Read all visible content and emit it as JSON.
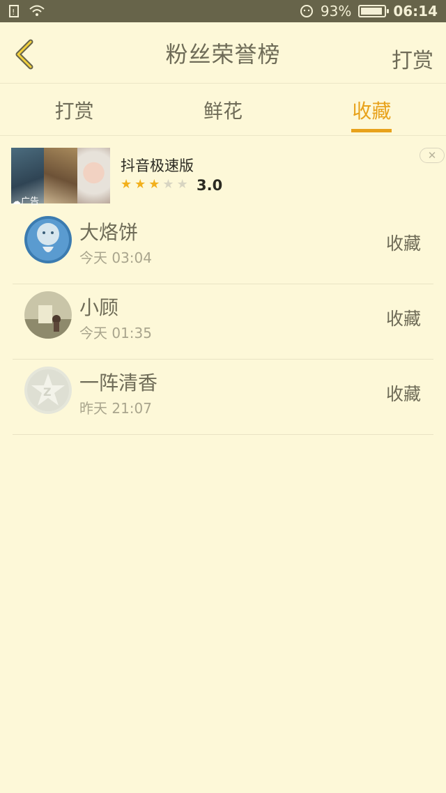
{
  "status_bar": {
    "battery": "93%",
    "battery_level": 0.93,
    "time": "06:14"
  },
  "header": {
    "title": "粉丝荣誉榜",
    "action_label": "打赏"
  },
  "tabs": [
    {
      "label": "打赏",
      "active": false
    },
    {
      "label": "鲜花",
      "active": false
    },
    {
      "label": "收藏",
      "active": true
    }
  ],
  "ad": {
    "name": "抖音极速版",
    "rating": "3.0",
    "stars_filled": 3,
    "stars_total": 5,
    "tag": "广告"
  },
  "fans": [
    {
      "name": "大烙饼",
      "time": "今天 03:04",
      "action": "收藏"
    },
    {
      "name": "小顾",
      "time": "今天 01:35",
      "action": "收藏"
    },
    {
      "name": "一阵清香",
      "time": "昨天 21:07",
      "action": "收藏"
    }
  ],
  "colors": {
    "accent": "#E8A21B",
    "background": "#FDF8D8",
    "status_bar": "#67644A"
  }
}
